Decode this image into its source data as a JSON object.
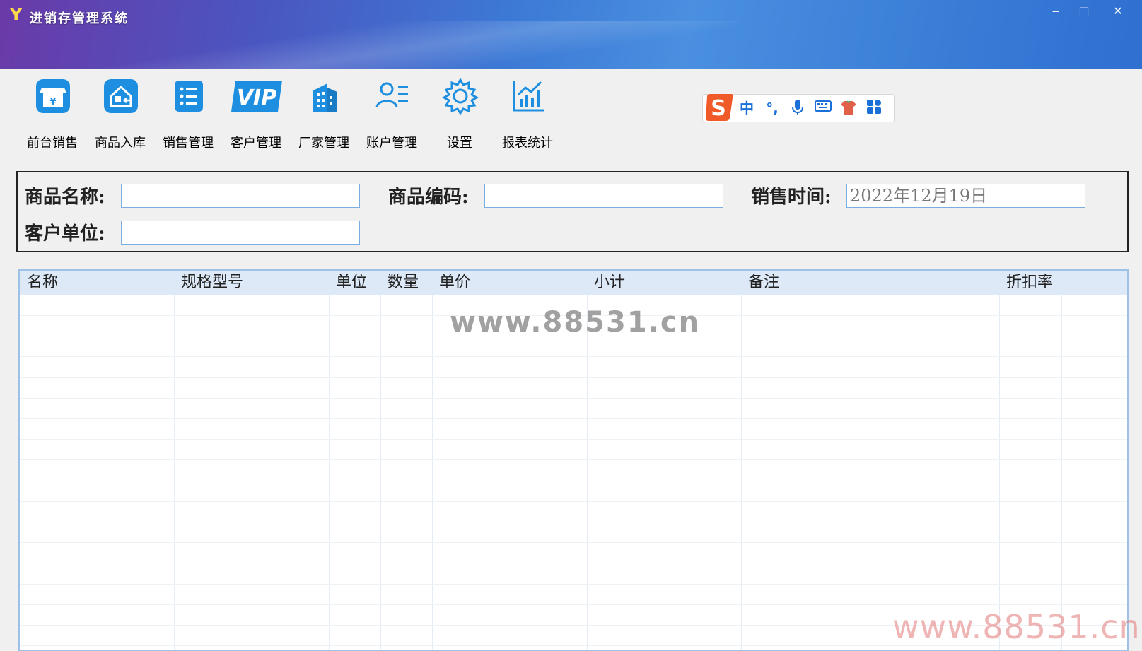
{
  "window": {
    "title": "进销存管理系统",
    "logo_glyph": "Y",
    "minimize": "‒",
    "maximize": "□",
    "close": "✕"
  },
  "toolbar": {
    "items": [
      {
        "label": "前台销售",
        "icon": "storefront-icon"
      },
      {
        "label": "商品入库",
        "icon": "warehouse-in-icon"
      },
      {
        "label": "销售管理",
        "icon": "list-icon"
      },
      {
        "label": "客户管理",
        "icon": "vip-icon"
      },
      {
        "label": "厂家管理",
        "icon": "building-icon"
      },
      {
        "label": "账户管理",
        "icon": "user-list-icon"
      },
      {
        "label": "设置",
        "icon": "gear-icon"
      },
      {
        "label": "报表统计",
        "icon": "chart-icon"
      }
    ]
  },
  "ime": {
    "mode": "中",
    "punct": "°,",
    "mic": "🎤",
    "keyboard": "⌨",
    "skin": "👕",
    "apps": "▦"
  },
  "search": {
    "product_name_label": "商品名称:",
    "product_name_value": "",
    "product_code_label": "商品编码:",
    "product_code_value": "",
    "sale_time_label": "销售时间:",
    "sale_time_value": "2022年12月19日",
    "customer_label": "客户单位:",
    "customer_value": ""
  },
  "grid": {
    "columns": [
      "名称",
      "规格型号",
      "单位",
      "数量",
      "单价",
      "小计",
      "备注",
      "折扣率"
    ],
    "rows": []
  },
  "watermarks": {
    "center": "www.88531.cn",
    "corner": "www.88531.cn"
  },
  "colors": {
    "title_gradient_start": "#6a3aa8",
    "title_gradient_end": "#2f6fd0",
    "icon_blue": "#1e8fe0",
    "grid_header": "#dde9f7",
    "ime_orange": "#f05a28"
  }
}
